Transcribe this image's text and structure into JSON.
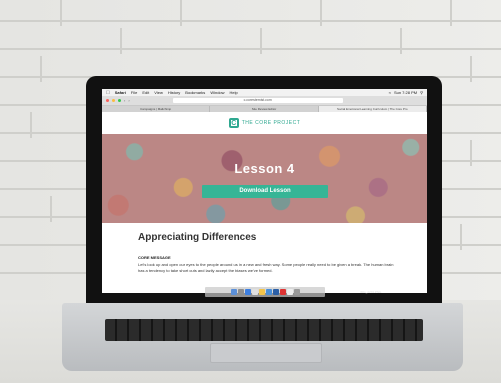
{
  "browser": {
    "menu": [
      "Safari",
      "File",
      "Edit",
      "View",
      "History",
      "Bookmarks",
      "Window",
      "Help"
    ],
    "status_right": "Sun 7:28 PM",
    "url": "c.corestemist.com",
    "tabs": [
      "Campaigns | Mailchimp",
      "Site Review Editor",
      "Social Emotional Learning Curriculum | The Core Pro"
    ]
  },
  "site": {
    "logo_letter": "C",
    "logo_text": "THE CORE PROJECT",
    "hero_title": "Lesson 4",
    "hero_button": "Download Lesson",
    "section_title": "Appreciating Differences",
    "message_label": "CORE MESSAGE",
    "message_text": "Let's look up and open our eyes to the people around us in a new and fresh way. Some people really need to be given a break. The human brain has a tendency to take short cuts and lazily accept the biases we've formed."
  },
  "dock": {
    "label": "IMG_2270.PNG"
  },
  "colors": {
    "accent": "#36b596",
    "logo": "#2fa890"
  }
}
